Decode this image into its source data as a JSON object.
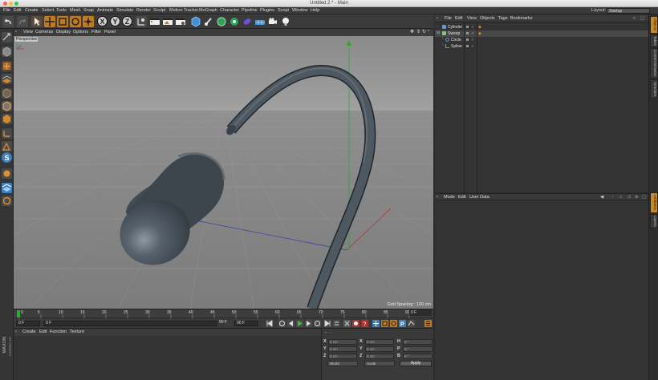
{
  "window": {
    "title": "Untitled 2 * - Main"
  },
  "menubar": {
    "items": [
      "File",
      "Edit",
      "Create",
      "Select",
      "Tools",
      "Mesh",
      "Snap",
      "Animate",
      "Simulate",
      "Render",
      "Sculpt",
      "Motion Tracker",
      "MoGraph",
      "Character",
      "Pipeline",
      "Plugins",
      "Script",
      "Window",
      "Help"
    ],
    "layout_label": "Layout:",
    "layout_value": "Startup"
  },
  "toolbar": {
    "axis_buttons": [
      "X",
      "Y",
      "Z"
    ]
  },
  "viewport": {
    "menu": [
      "View",
      "Cameras",
      "Display",
      "Options",
      "Filter",
      "Panel"
    ],
    "camera_label": "Perspective",
    "grid_spacing": "Grid Spacing : 100 cm"
  },
  "timeline": {
    "ticks": [
      "0",
      "5",
      "10",
      "15",
      "20",
      "25",
      "30",
      "35",
      "40",
      "45",
      "50",
      "55",
      "60",
      "65",
      "70",
      "75",
      "80",
      "85",
      "90"
    ],
    "current_frame": "0 F"
  },
  "transport": {
    "start_field": "0 F",
    "current_field": "0 F",
    "preview_end": "90 F",
    "end_field": "90 F"
  },
  "material_manager": {
    "menu": [
      "Create",
      "Edit",
      "Function",
      "Texture"
    ],
    "brand_top": "MAXON",
    "brand_bottom": "CINEMA 4D"
  },
  "coordinates": {
    "header": "--",
    "rows": [
      {
        "axis": "X",
        "pos": "0 cm",
        "size_axis": "X",
        "size": "0 cm",
        "rot_axis": "H",
        "rot": "0 °"
      },
      {
        "axis": "Y",
        "pos": "0 cm",
        "size_axis": "Y",
        "size": "0 cm",
        "rot_axis": "P",
        "rot": "0 °"
      },
      {
        "axis": "Z",
        "pos": "0 cm",
        "size_axis": "Z",
        "size": "0 cm",
        "rot_axis": "B",
        "rot": "0 °"
      }
    ],
    "mode_select": "World",
    "size_select": "Scale",
    "apply_label": "Apply"
  },
  "object_manager": {
    "menu": [
      "File",
      "Edit",
      "View",
      "Objects",
      "Tags",
      "Bookmarks"
    ],
    "objects": [
      {
        "name": "Cylinder",
        "level": 0,
        "icon_color": "#5a9ad6"
      },
      {
        "name": "Sweep",
        "level": 0,
        "icon_color": "#7fc97f"
      },
      {
        "name": "Circle",
        "level": 1,
        "icon_color": "#5a9ad6"
      },
      {
        "name": "Spline",
        "level": 1,
        "icon_color": "#5a9ad6"
      }
    ]
  },
  "attributes": {
    "menu": [
      "Mode",
      "Edit",
      "User Data"
    ]
  },
  "side_tabs": {
    "top": [
      "Objects",
      "Takes",
      "Content Browser",
      "Structure"
    ],
    "bottom": [
      "Attributes",
      "Layers"
    ]
  },
  "colors": {
    "accent": "#c78a2a",
    "viewport_bg": "#8e8e8e",
    "object_dark": "#3d464d"
  }
}
